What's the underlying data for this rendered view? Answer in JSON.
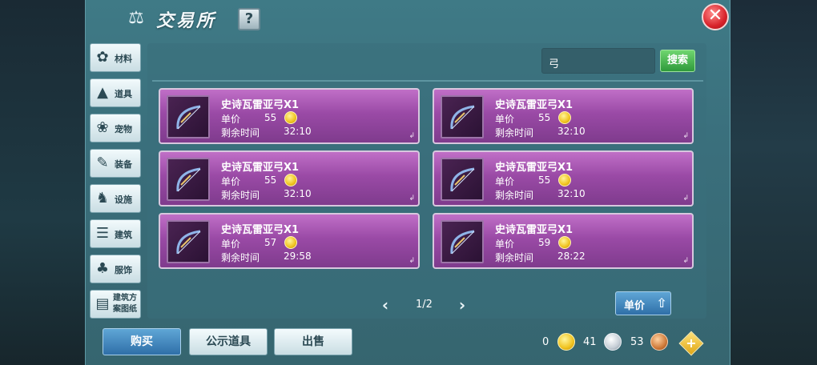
{
  "header": {
    "title": "交易所",
    "help_label": "?",
    "close_label": "✕"
  },
  "sidebar": {
    "items": [
      {
        "label": "材料",
        "icon": "materials-icon"
      },
      {
        "label": "道具",
        "icon": "item-icon"
      },
      {
        "label": "宠物",
        "icon": "paw-icon"
      },
      {
        "label": "装备",
        "icon": "equipment-icon"
      },
      {
        "label": "设施",
        "icon": "facility-icon"
      },
      {
        "label": "建筑",
        "icon": "building-icon"
      },
      {
        "label": "服饰",
        "icon": "clothing-icon"
      },
      {
        "label": "建筑方案图纸",
        "icon": "blueprint-icon"
      }
    ]
  },
  "search": {
    "value": "弓",
    "button_label": "搜索"
  },
  "listings": [
    {
      "name": "史诗瓦雷亚弓X1",
      "price_label": "单价",
      "price": "55",
      "time_label": "剩余时间",
      "time": "32:10"
    },
    {
      "name": "史诗瓦雷亚弓X1",
      "price_label": "单价",
      "price": "55",
      "time_label": "剩余时间",
      "time": "32:10"
    },
    {
      "name": "史诗瓦雷亚弓X1",
      "price_label": "单价",
      "price": "55",
      "time_label": "剩余时间",
      "time": "32:10"
    },
    {
      "name": "史诗瓦雷亚弓X1",
      "price_label": "单价",
      "price": "55",
      "time_label": "剩余时间",
      "time": "32:10"
    },
    {
      "name": "史诗瓦雷亚弓X1",
      "price_label": "单价",
      "price": "57",
      "time_label": "剩余时间",
      "time": "29:58"
    },
    {
      "name": "史诗瓦雷亚弓X1",
      "price_label": "单价",
      "price": "59",
      "time_label": "剩余时间",
      "time": "28:22"
    }
  ],
  "pager": {
    "text": "1/2"
  },
  "sort": {
    "label": "单价"
  },
  "actions": {
    "buy": "购买",
    "publish": "公示道具",
    "sell": "出售"
  },
  "currency": {
    "gold": "0",
    "silver": "41",
    "copper": "53"
  },
  "colors": {
    "card": "#9a4aa6",
    "search_button": "#2f9a3b",
    "primary_button": "#2f6fa8",
    "close": "#d8232b"
  }
}
